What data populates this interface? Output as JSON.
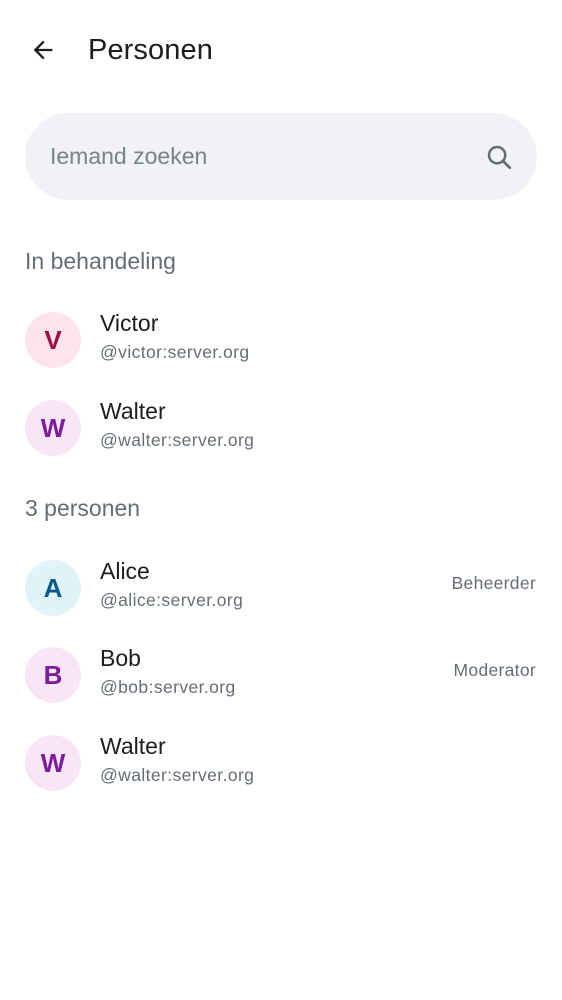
{
  "header": {
    "title": "Personen",
    "back_icon": "arrow-left-icon"
  },
  "search": {
    "placeholder": "Iemand zoeken",
    "value": "",
    "icon": "search-icon"
  },
  "pending": {
    "title": "In behandeling",
    "members": [
      {
        "initial": "V",
        "name": "Victor",
        "handle": "@victor:server.org",
        "avatar_bg": "#fde4ea",
        "avatar_fg": "#9b0a4a"
      },
      {
        "initial": "W",
        "name": "Walter",
        "handle": "@walter:server.org",
        "avatar_bg": "#f8e6f7",
        "avatar_fg": "#7d1c9b"
      }
    ]
  },
  "joined": {
    "title": "3 personen",
    "members": [
      {
        "initial": "A",
        "name": "Alice",
        "handle": "@alice:server.org",
        "role": "Beheerder",
        "avatar_bg": "#e0f3f9",
        "avatar_fg": "#0a5b8a"
      },
      {
        "initial": "B",
        "name": "Bob",
        "handle": "@bob:server.org",
        "role": "Moderator",
        "avatar_bg": "#f8e6f7",
        "avatar_fg": "#7d1c9b"
      },
      {
        "initial": "W",
        "name": "Walter",
        "handle": "@walter:server.org",
        "role": "",
        "avatar_bg": "#f8e6f7",
        "avatar_fg": "#7d1c9b"
      }
    ]
  }
}
